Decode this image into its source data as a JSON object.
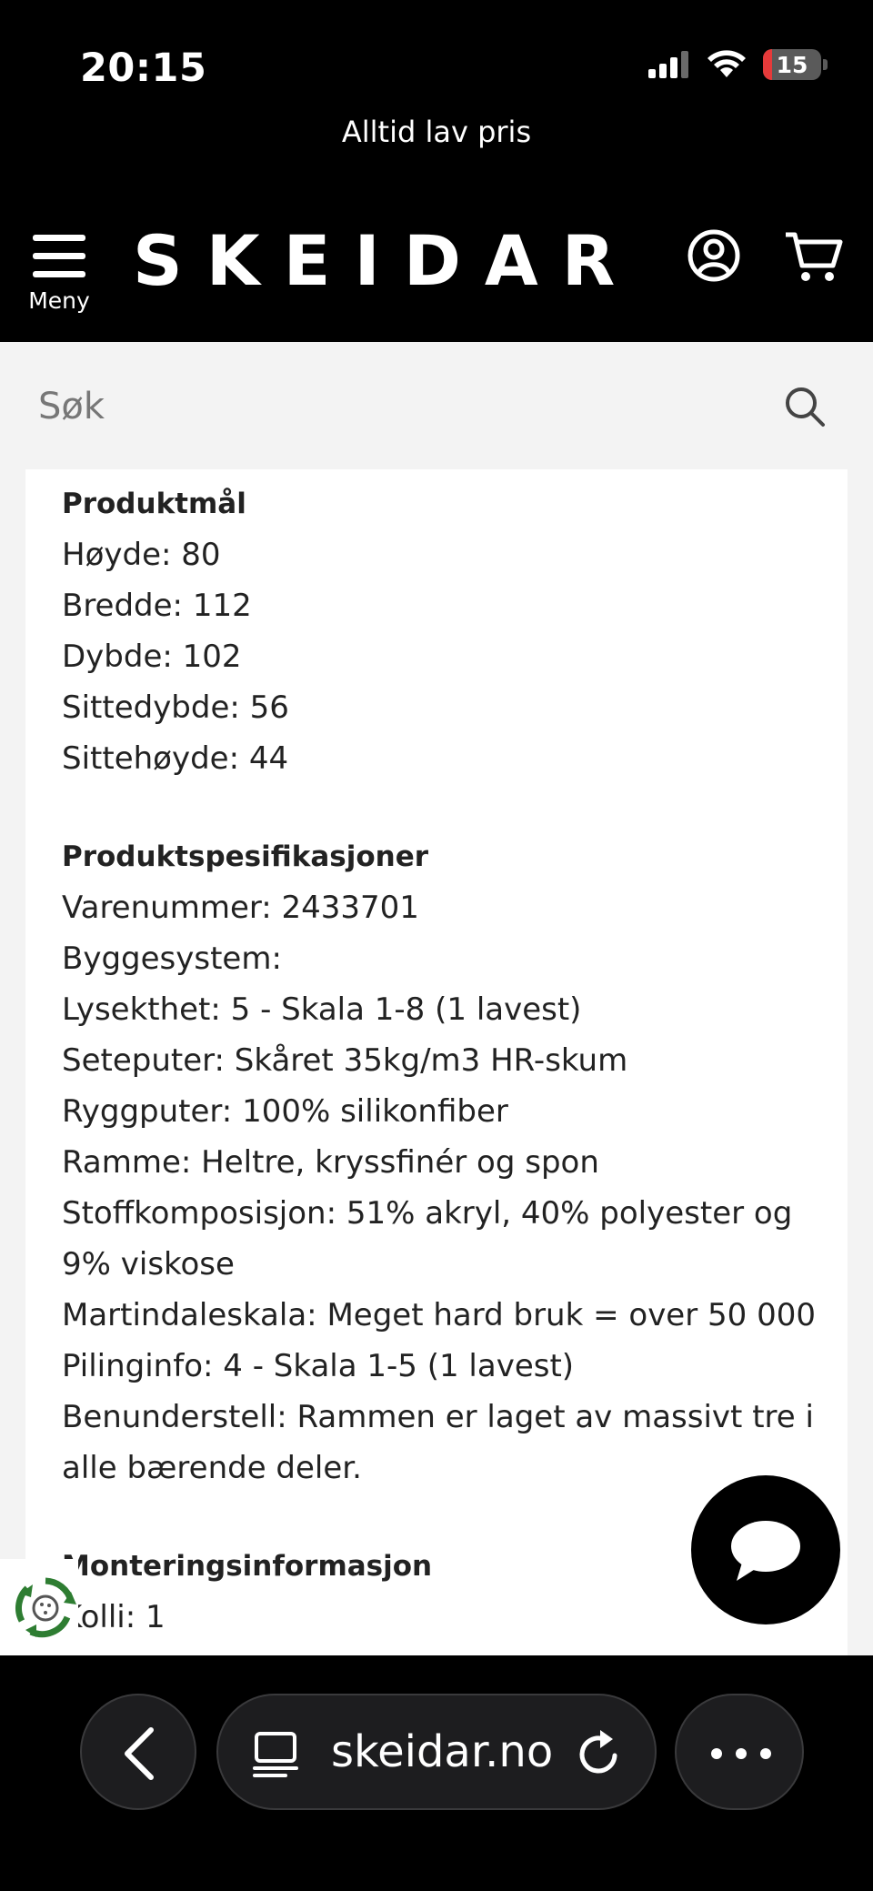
{
  "status_bar": {
    "time": "20:15",
    "battery_level": "15",
    "battery_fraction": 0.15,
    "icons": [
      "cellular-signal-icon",
      "wifi-icon",
      "battery-icon"
    ],
    "battery_color": "#e63a3a"
  },
  "announcement": {
    "text": "Alltid lav pris"
  },
  "header": {
    "menu_label": "Meny",
    "logo": "SKEIDAR",
    "icons": [
      "menu-icon",
      "account-icon",
      "cart-icon"
    ],
    "background": "#000000"
  },
  "search": {
    "placeholder": "Søk",
    "value": "",
    "icon": "search-icon"
  },
  "product_dimensions": {
    "title": "Produktmål",
    "items": [
      "Høyde: 80",
      "Bredde: 112",
      "Dybde: 102",
      "Sittedybde: 56",
      "Sittehøyde: 44"
    ]
  },
  "product_specs": {
    "title": "Produktspesifikasjoner",
    "items": [
      "Varenummer: 2433701",
      "Byggesystem:",
      "Lysekthet: 5 - Skala 1-8 (1 lavest)",
      "Seteputer: Skåret 35kg/m3 HR-skum",
      "Ryggputer: 100% silikonfiber",
      "Ramme: Heltre, kryssfinér og spon",
      "Stoffkomposisjon: 51% akryl, 40% polyester og 9% viskose",
      "Martindaleskala: Meget hard bruk = over 50 000",
      "Pilinginfo: 4 - Skala 1-5 (1 lavest)",
      "Benunderstell: Rammen er laget av massivt tre i alle bærende deler."
    ]
  },
  "assembly": {
    "title": "Monteringsinformasjon",
    "partial_line": "Kolli: 1"
  },
  "floating": {
    "chat_icon": "chat-bubble-icon",
    "eco_icon": "recycle-badge-icon"
  },
  "browser": {
    "url": "skeidar.no",
    "icons": [
      "back-icon",
      "tabs-icon",
      "reload-icon",
      "more-icon"
    ]
  }
}
